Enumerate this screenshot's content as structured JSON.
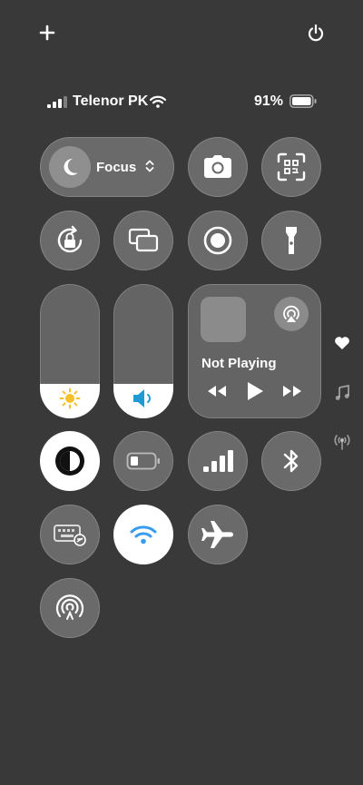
{
  "top_bar": {
    "add_icon": "plus-icon",
    "power_icon": "power-icon"
  },
  "status_bar": {
    "carrier": "Telenor PK",
    "battery_percent": "91%",
    "signal_bars": 3,
    "battery_level": 0.91
  },
  "controls": {
    "focus": {
      "label": "Focus",
      "icon": "moon-icon"
    },
    "brightness_level": 0.26,
    "volume_level": 0.26,
    "now_playing": {
      "title": "Not Playing"
    }
  },
  "side_indicators": [
    "heart-icon",
    "music-note-icon",
    "antenna-icon"
  ],
  "colors": {
    "background": "#393939",
    "tile": "rgba(255,255,255,0.25)",
    "brightness_icon": "#f5c02a",
    "volume_icon": "#1e9bd7",
    "wifi_active": "#3a9cf0"
  }
}
